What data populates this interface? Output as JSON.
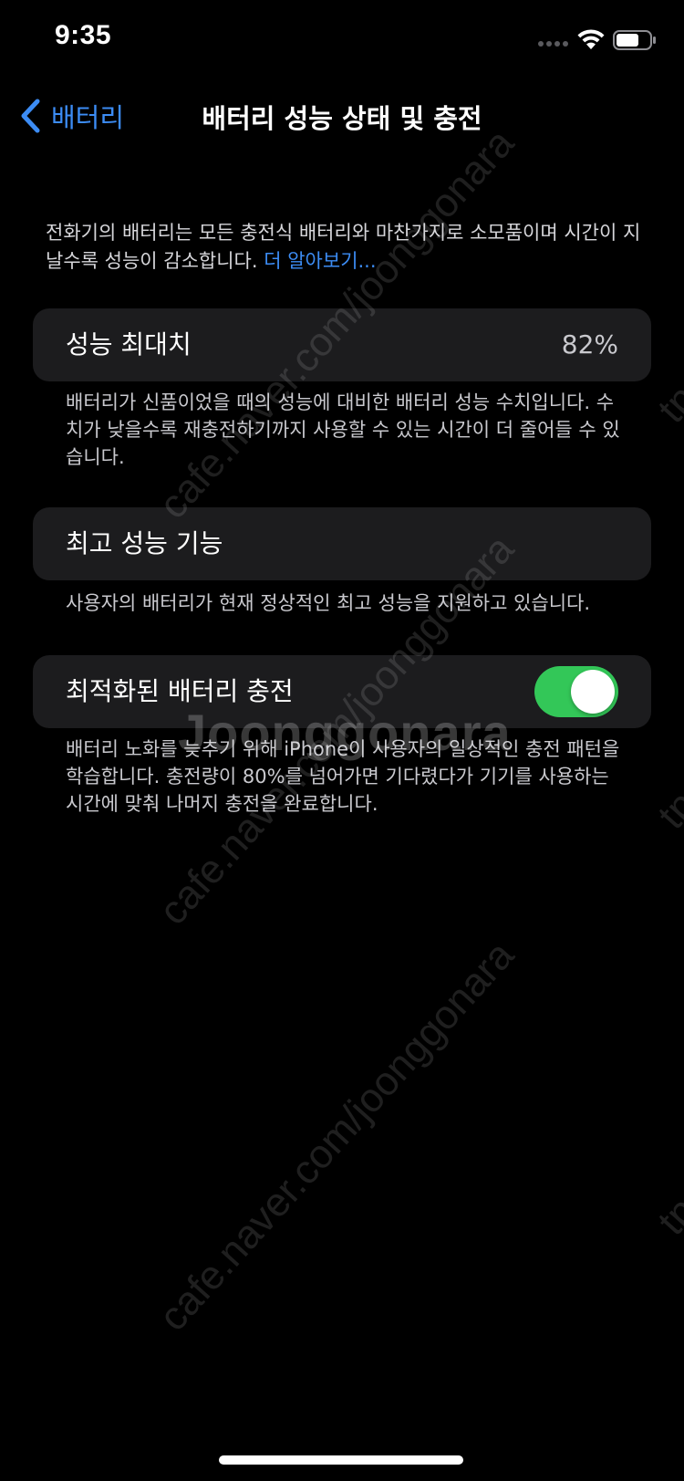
{
  "status_bar": {
    "time": "9:35",
    "wifi_icon": "wifi-icon",
    "battery_icon": "battery-icon"
  },
  "nav": {
    "back_label": "배터리",
    "title": "배터리 성능 상태 및 충전"
  },
  "intro": {
    "text": "전화기의 배터리는 모든 충전식 배터리와 마찬가지로 소모품이며 시간이 지날수록 성능이 감소합니다. ",
    "link": "더 알아보기..."
  },
  "max_capacity": {
    "label": "성능 최대치",
    "value": "82%",
    "footnote": "배터리가 신품이었을 때의 성능에 대비한 배터리 성능 수치입니다. 수치가 낮을수록 재충전하기까지 사용할 수 있는 시간이 더 줄어들 수 있습니다."
  },
  "peak_performance": {
    "label": "최고 성능 기능",
    "footnote": "사용자의 배터리가 현재 정상적인 최고 성능을 지원하고 있습니다."
  },
  "optimized_charging": {
    "label": "최적화된 배터리 충전",
    "enabled": true,
    "footnote": "배터리 노화를 늦추기 위해 iPhone이 사용자의 일상적인 충전 패턴을 학습합니다. 충전량이 80%를 넘어가면 기다렸다가 기기를 사용하는 시간에 맞춰 나머지 충전을 완료합니다."
  },
  "watermark": {
    "url": "cafe.naver.com/joonggonara",
    "brand": "Joonggonara",
    "edge": "tp"
  },
  "colors": {
    "accent_blue": "#3c8cf4",
    "toggle_on": "#33c758",
    "cell_bg": "#1c1c1e"
  }
}
